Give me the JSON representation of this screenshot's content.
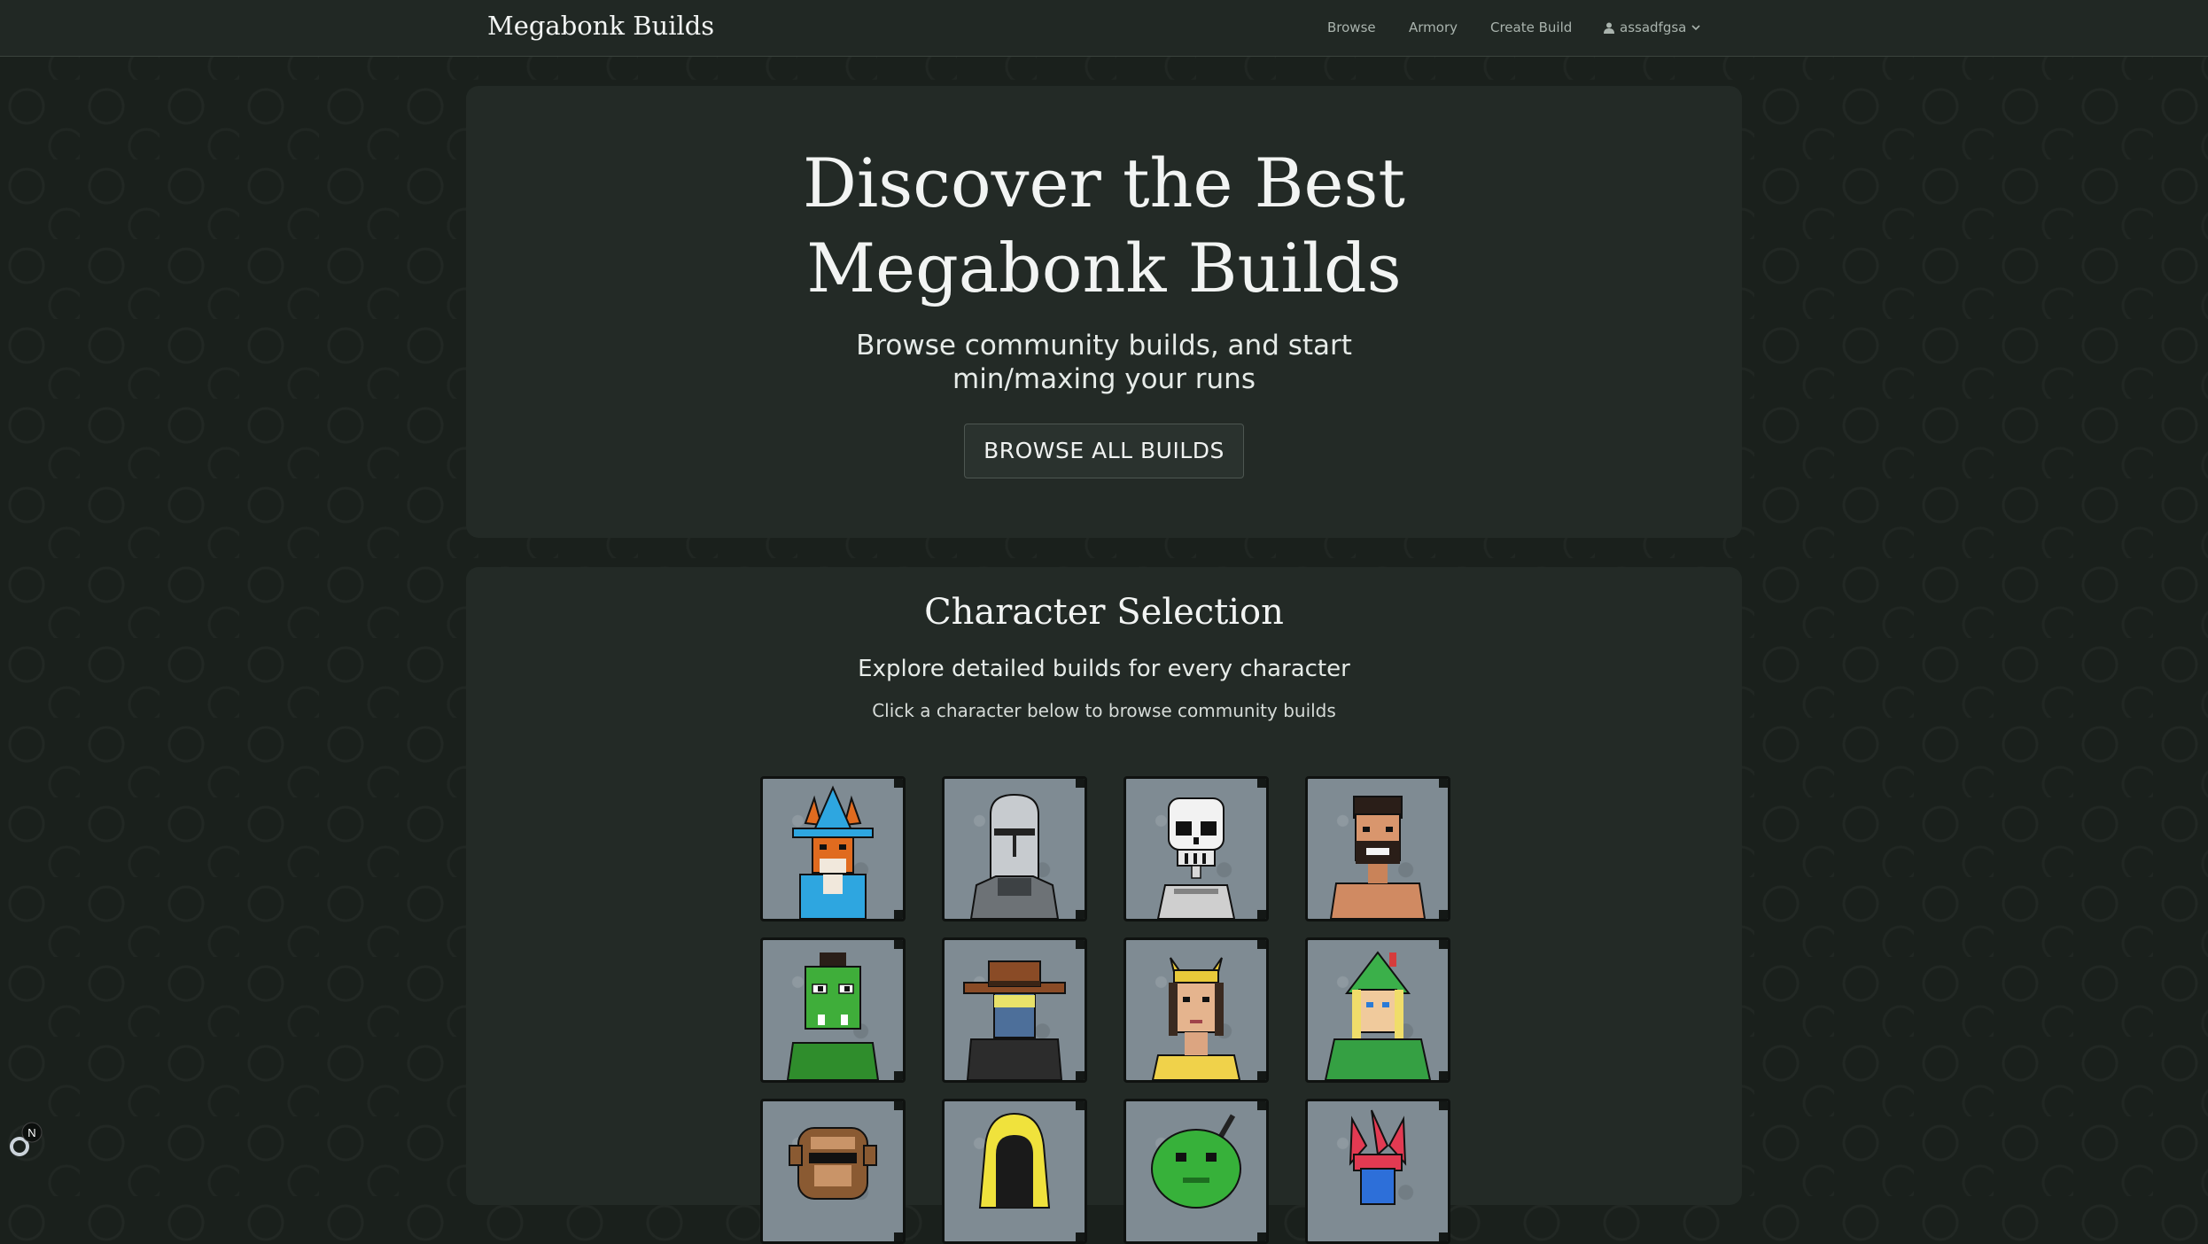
{
  "nav": {
    "brand": "Megabonk Builds",
    "links": [
      "Browse",
      "Armory",
      "Create Build"
    ],
    "user": "assadfgsa"
  },
  "hero": {
    "title_line1": "Discover the Best",
    "title_line2": "Megabonk Builds",
    "subtitle_line1": "Browse community builds, and start",
    "subtitle_line2": "min/maxing your runs",
    "button": "BROWSE ALL BUILDS"
  },
  "characters": {
    "title": "Character Selection",
    "subtitle": "Explore detailed builds for every character",
    "hint": "Click a character below to browse community builds",
    "items": [
      {
        "icon": "fox-wizard-portrait-icon"
      },
      {
        "icon": "armored-knight-portrait-icon"
      },
      {
        "icon": "skeleton-portrait-icon"
      },
      {
        "icon": "bearded-man-portrait-icon"
      },
      {
        "icon": "green-orc-portrait-icon"
      },
      {
        "icon": "cowboy-portrait-icon"
      },
      {
        "icon": "horned-warrior-portrait-icon"
      },
      {
        "icon": "green-hood-archer-portrait-icon"
      },
      {
        "icon": "monkey-portrait-icon"
      },
      {
        "icon": "yellow-hood-portrait-icon"
      },
      {
        "icon": "green-creature-portrait-icon"
      },
      {
        "icon": "red-jester-portrait-icon"
      }
    ]
  },
  "colors": {
    "background": "#1a201c",
    "panel": "#232a26",
    "navbar": "#212824"
  }
}
